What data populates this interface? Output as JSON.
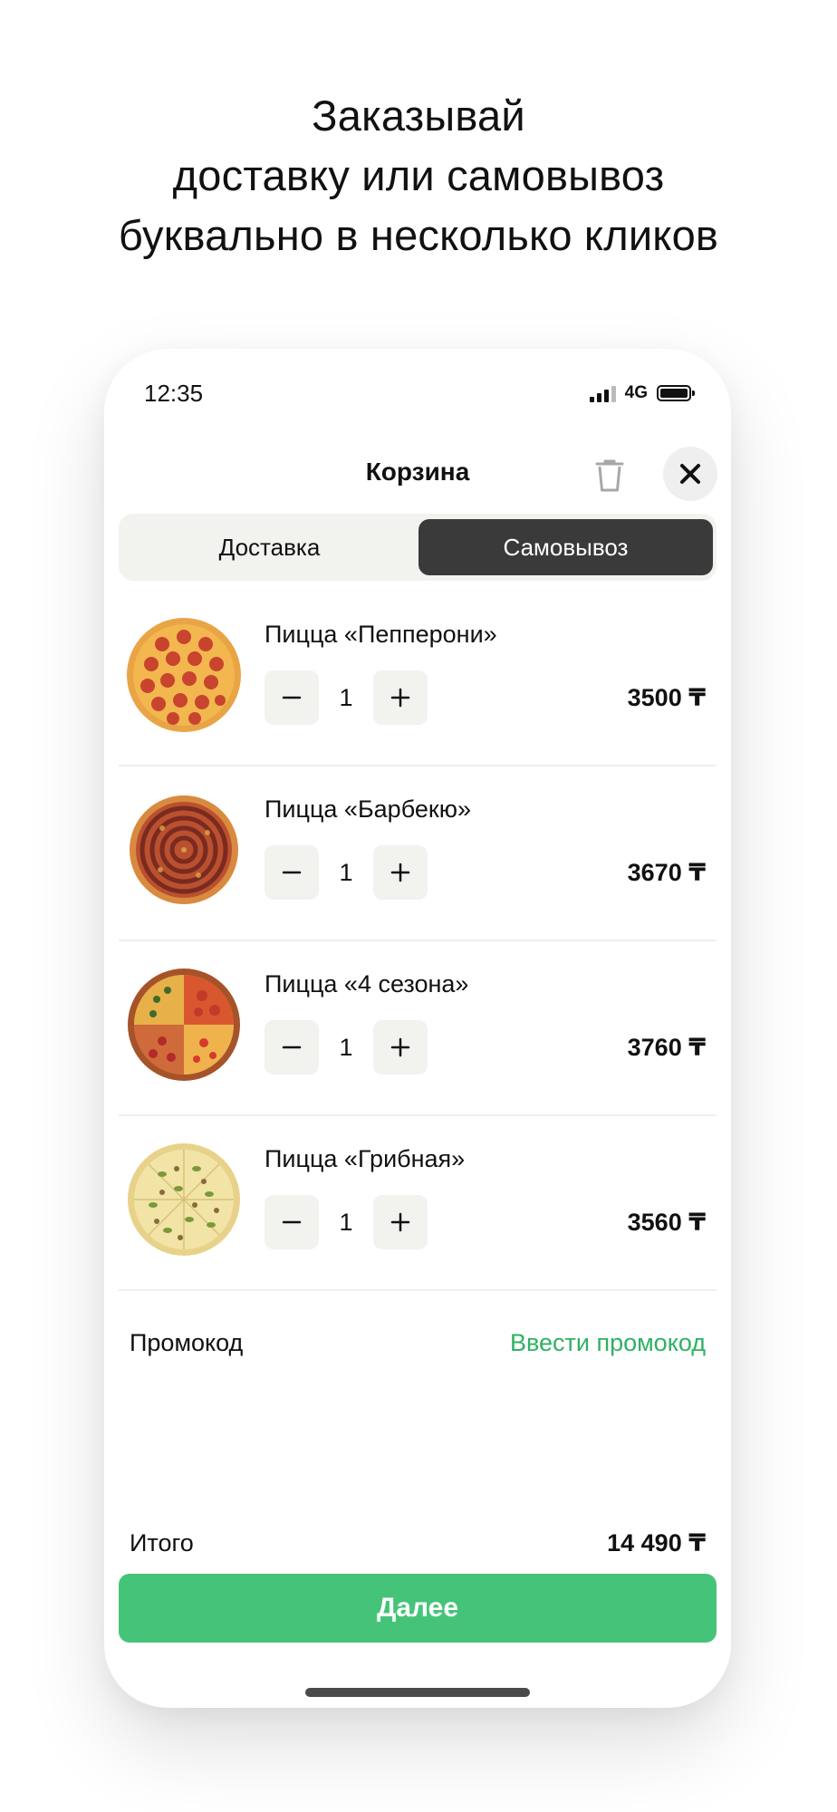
{
  "headline": {
    "line1": "Заказывай",
    "line2": "доставку или самовывоз",
    "line3": "буквально в несколько кликов"
  },
  "status_bar": {
    "time": "12:35",
    "network": "4G"
  },
  "header": {
    "title": "Корзина",
    "icons": [
      "trash-icon",
      "close-icon"
    ]
  },
  "tabs": {
    "delivery": "Доставка",
    "pickup": "Самовывоз",
    "selected": "pickup"
  },
  "cart": {
    "items": [
      {
        "name": "Пицца «Пепперони»",
        "qty": "1",
        "price": "3500 ₸",
        "image": "pepperoni-pizza-image"
      },
      {
        "name": "Пицца «Барбекю»",
        "qty": "1",
        "price": "3670 ₸",
        "image": "bbq-pizza-image"
      },
      {
        "name": "Пицца «4 сезона»",
        "qty": "1",
        "price": "3760 ₸",
        "image": "four-seasons-pizza-image"
      },
      {
        "name": "Пицца «Грибная»",
        "qty": "1",
        "price": "3560 ₸",
        "image": "mushroom-pizza-image"
      }
    ]
  },
  "promo": {
    "label": "Промокод",
    "action": "Ввести промокод"
  },
  "summary": {
    "total_label": "Итого",
    "total_value": "14 490 ₸"
  },
  "cta": {
    "label": "Далее"
  },
  "colors": {
    "accent": "#45c479",
    "link": "#2fb163",
    "segment_active": "#3a3a3a",
    "control_bg": "#f2f2ef"
  }
}
